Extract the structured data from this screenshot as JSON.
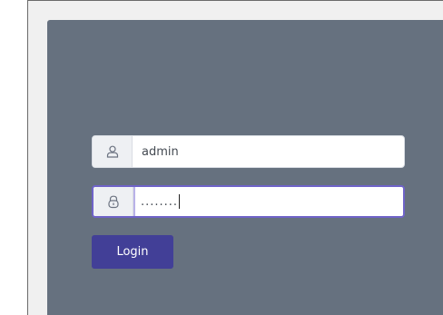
{
  "login": {
    "username": {
      "icon": "user-icon",
      "value": "admin"
    },
    "password": {
      "icon": "lock-icon",
      "value": "........"
    },
    "button_label": "Login"
  },
  "colors": {
    "panel": "#66717f",
    "button": "#423f97",
    "focus_border": "#6f63c8"
  }
}
